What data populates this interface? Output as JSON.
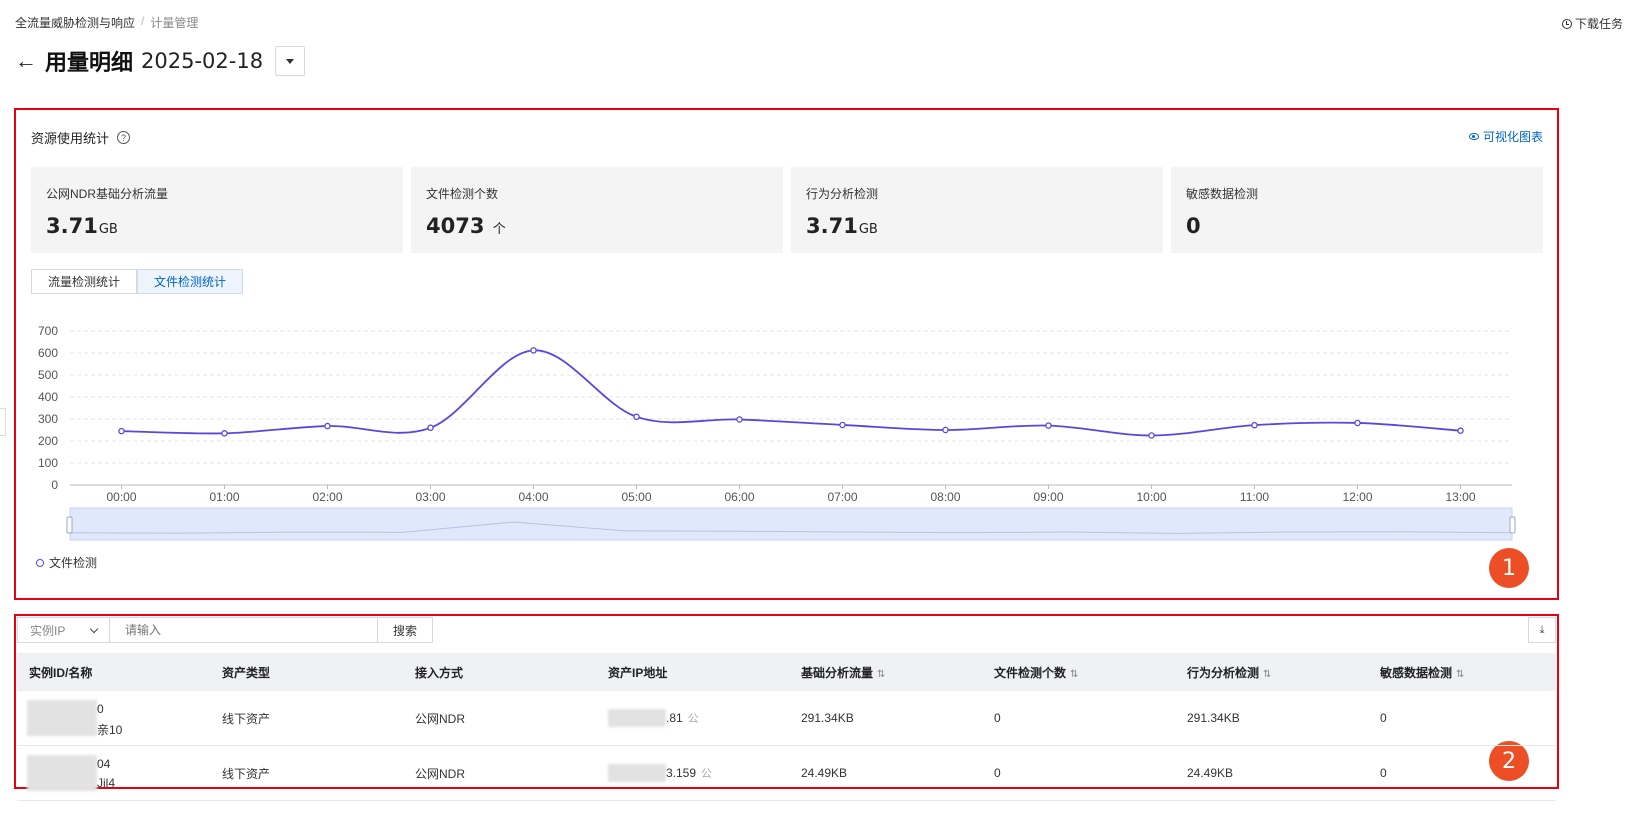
{
  "breadcrumb": [
    "全流量威胁检测与响应",
    "计量管理"
  ],
  "header": {
    "download_label": "下载任务",
    "title": "用量明细",
    "date": "2025-02-18"
  },
  "stats": {
    "title": "资源使用统计",
    "help_icon": "question-icon",
    "visual_label": "可视化图表",
    "cards": [
      {
        "label": "公网NDR基础分析流量",
        "value": "3.71",
        "unit": "GB"
      },
      {
        "label": "文件检测个数",
        "value": "4073",
        "unit": "个"
      },
      {
        "label": "行为分析检测",
        "value": "3.71",
        "unit": "GB"
      },
      {
        "label": "敏感数据检测",
        "value": "0",
        "unit": ""
      }
    ],
    "tabs": [
      "流量检测统计",
      "文件检测统计"
    ],
    "active_tab": 1
  },
  "chart_data": {
    "type": "line",
    "x": [
      "00:00",
      "01:00",
      "02:00",
      "03:00",
      "04:00",
      "05:00",
      "06:00",
      "07:00",
      "08:00",
      "09:00",
      "10:00",
      "11:00",
      "12:00",
      "13:00"
    ],
    "series": [
      {
        "name": "文件检测",
        "values": [
          245,
          235,
          268,
          260,
          612,
          310,
          298,
          273,
          250,
          270,
          225,
          272,
          282,
          247
        ]
      }
    ],
    "yticks": [
      0,
      100,
      200,
      300,
      400,
      500,
      600,
      700
    ],
    "ylim": [
      0,
      700
    ],
    "grid": true,
    "legend": "bottom-left",
    "color": "#5b45e0"
  },
  "filter": {
    "select": "实例IP",
    "placeholder": "请输入",
    "search_label": "搜索"
  },
  "table": {
    "columns": [
      "实例ID/名称",
      "资产类型",
      "接入方式",
      "资产IP地址",
      "基础分析流量",
      "文件检测个数",
      "行为分析检测",
      "敏感数据检测"
    ],
    "sortable_mark": "⇅",
    "rows": [
      {
        "id_line1": "0",
        "id_line2": "亲10",
        "type": "线下资产",
        "access": "公网NDR",
        "ip": ".81",
        "ip_tag": "公",
        "traffic": "291.34KB",
        "files": "0",
        "behavior": "291.34KB",
        "sensitive": "0"
      },
      {
        "id_line1": "04",
        "id_line2": "Jil4",
        "type": "线下资产",
        "access": "公网NDR",
        "ip": "3.159",
        "ip_tag": "公",
        "traffic": "24.49KB",
        "files": "0",
        "behavior": "24.49KB",
        "sensitive": "0"
      }
    ]
  },
  "badges": [
    "1",
    "2"
  ]
}
